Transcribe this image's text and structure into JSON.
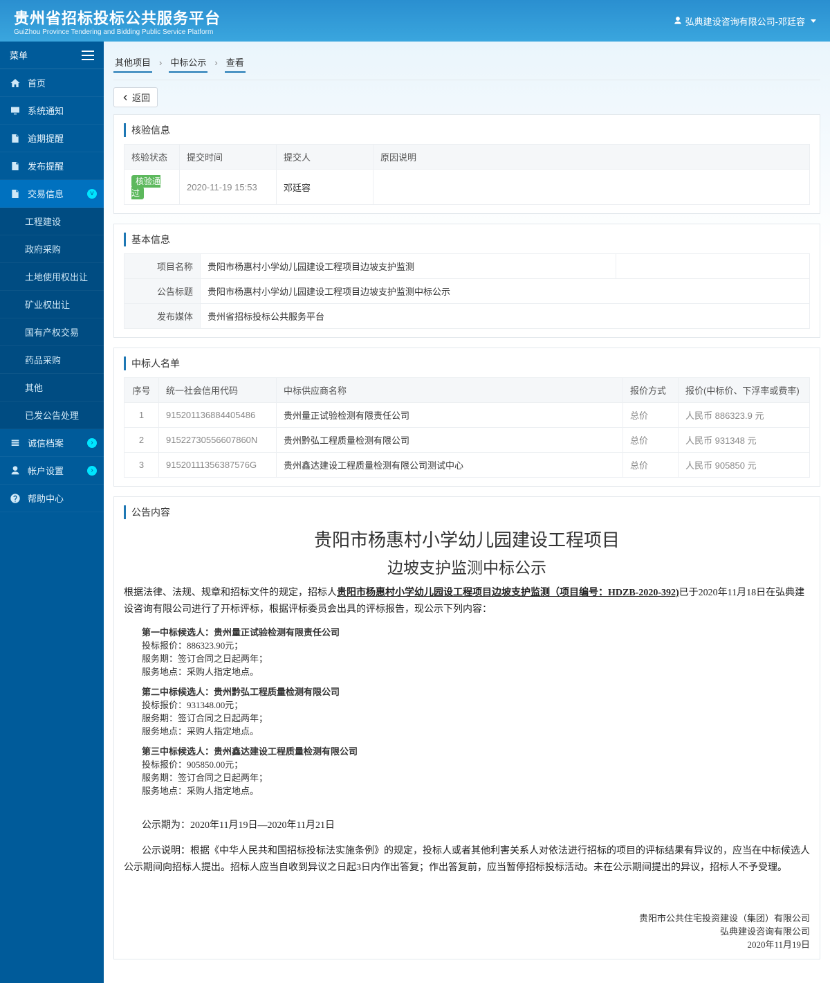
{
  "header": {
    "brand_cn": "贵州省招标投标公共服务平台",
    "brand_en": "GuiZhou Province Tendering and Bidding Public Service Platform",
    "user_label": "弘典建设咨询有限公司-邓廷容"
  },
  "sidebar": {
    "menu_label": "菜单",
    "items": [
      {
        "label": "首页",
        "icon": "home"
      },
      {
        "label": "系统通知",
        "icon": "monitor"
      },
      {
        "label": "逾期提醒",
        "icon": "doc"
      },
      {
        "label": "发布提醒",
        "icon": "doc"
      },
      {
        "label": "交易信息",
        "icon": "doc",
        "active": true,
        "mark": "v"
      },
      {
        "label": "诚信档案",
        "icon": "list",
        "mark": "›"
      },
      {
        "label": "帐户设置",
        "icon": "user",
        "mark": "›"
      },
      {
        "label": "帮助中心",
        "icon": "help"
      }
    ],
    "subitems": [
      "工程建设",
      "政府采购",
      "土地使用权出让",
      "矿业权出让",
      "国有产权交易",
      "药品采购",
      "其他",
      "已发公告处理"
    ]
  },
  "breadcrumb": {
    "a": "其他项目",
    "b": "中标公示",
    "c": "查看"
  },
  "back_label": "返回",
  "panel_audit": {
    "title": "核验信息",
    "cols": {
      "status": "核验状态",
      "time": "提交时间",
      "submitter": "提交人",
      "reason": "原因说明"
    },
    "row": {
      "status": "核验通过",
      "time": "2020-11-19 15:53",
      "submitter": "邓廷容",
      "reason": ""
    }
  },
  "panel_basic": {
    "title": "基本信息",
    "rows": {
      "prj_name_l": "项目名称",
      "prj_name_v": "贵阳市杨惠村小学幼儿园建设工程项目边坡支护监测",
      "ann_title_l": "公告标题",
      "ann_title_v": "贵阳市杨惠村小学幼儿园建设工程项目边坡支护监测中标公示",
      "media_l": "发布媒体",
      "media_v": "贵州省招标投标公共服务平台"
    }
  },
  "panel_winners": {
    "title": "中标人名单",
    "cols": {
      "no": "序号",
      "code": "统一社会信用代码",
      "name": "中标供应商名称",
      "method": "报价方式",
      "price": "报价(中标价、下浮率或费率)"
    },
    "rows": [
      {
        "no": "1",
        "code": "915201136884405486",
        "name": "贵州量正试验检测有限责任公司",
        "method": "总价",
        "price": "人民币 886323.9 元"
      },
      {
        "no": "2",
        "code": "91522730556607860N",
        "name": "贵州黔弘工程质量检测有限公司",
        "method": "总价",
        "price": "人民币 931348 元"
      },
      {
        "no": "3",
        "code": "91520111356387576G",
        "name": "贵州鑫达建设工程质量检测有限公司测试中心",
        "method": "总价",
        "price": "人民币 905850 元"
      }
    ]
  },
  "panel_content": {
    "title": "公告内容",
    "h1": "贵阳市杨惠村小学幼儿园建设工程项目",
    "h2": "边坡支护监测中标公示",
    "intro_a": "根据法律、法规、规章和招标文件的规定，招标人",
    "intro_u": "贵阳市杨惠村小学幼儿园设工程项目边坡支护监测（项目编号：HDZB-2020-392)",
    "intro_b": "已于2020年11月18日在弘典建设咨询有限公司进行了开标评标，根据评标委员会出具的评标报告，现公示下列内容：",
    "cands": [
      {
        "t": "第一中标候选人：贵州量正试验检测有限责任公司",
        "p": "投标报价：886323.90元；",
        "s": "服务期：签订合同之日起两年；",
        "l": "服务地点：采购人指定地点。"
      },
      {
        "t": "第二中标候选人：贵州黔弘工程质量检测有限公司",
        "p": "投标报价：931348.00元；",
        "s": "服务期：签订合同之日起两年；",
        "l": "服务地点：采购人指定地点。"
      },
      {
        "t": "第三中标候选人：贵州鑫达建设工程质量检测有限公司",
        "p": "投标报价：905850.00元；",
        "s": "服务期：签订合同之日起两年；",
        "l": "服务地点：采购人指定地点。"
      }
    ],
    "period": "公示期为：2020年11月19日—2020年11月21日",
    "note": "公示说明：根据《中华人民共和国招标投标法实施条例》的规定，投标人或者其他利害关系人对依法进行招标的项目的评标结果有异议的，应当在中标候选人公示期间向招标人提出。招标人应当自收到异议之日起3日内作出答复；作出答复前，应当暂停招标投标活动。未在公示期间提出的异议，招标人不予受理。",
    "sig1": "贵阳市公共住宅投资建设（集团）有限公司",
    "sig2": "弘典建设咨询有限公司",
    "sig3": "2020年11月19日"
  }
}
